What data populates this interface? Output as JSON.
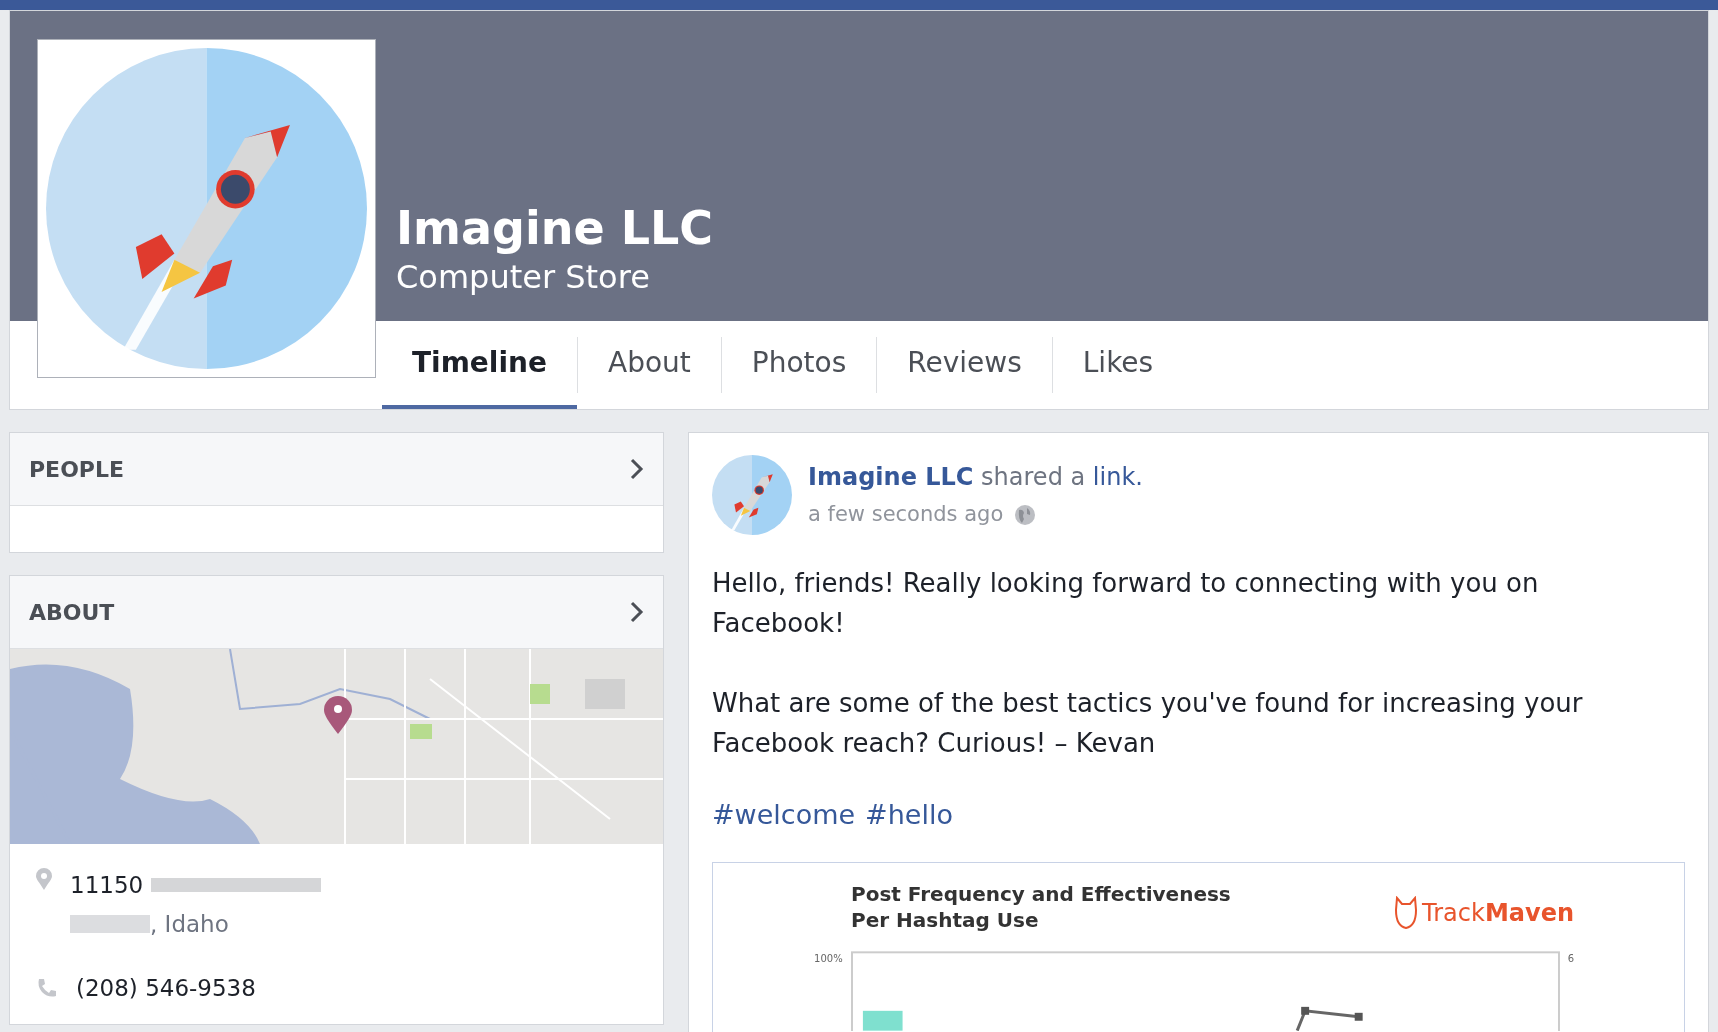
{
  "page": {
    "name": "Imagine LLC",
    "category": "Computer Store"
  },
  "tabs": [
    {
      "label": "Timeline",
      "selected": true
    },
    {
      "label": "About",
      "selected": false
    },
    {
      "label": "Photos",
      "selected": false
    },
    {
      "label": "Reviews",
      "selected": false
    },
    {
      "label": "Likes",
      "selected": false
    }
  ],
  "sidebar": {
    "people": {
      "title": "PEOPLE"
    },
    "about": {
      "title": "ABOUT",
      "address_line_1": "11150",
      "address_line_2": ", Idaho",
      "phone": "(208) 546-9538"
    }
  },
  "post": {
    "author": "Imagine LLC",
    "action": "shared a",
    "link": "link.",
    "time": "a few seconds ago",
    "paragraphs": [
      "Hello, friends! Really looking forward to connecting with you on Facebook!",
      "What are some of the best tactics you've found for increasing your Facebook reach? Curious! – Kevan"
    ],
    "hashtags": [
      "#welcome",
      "#hello"
    ],
    "attachment": {
      "title": "Post Frequency and Effectiveness Per Hashtag Use",
      "brand_light": "Track",
      "brand_bold": "Maven",
      "left_tick": "100%",
      "right_tick": "6"
    }
  }
}
